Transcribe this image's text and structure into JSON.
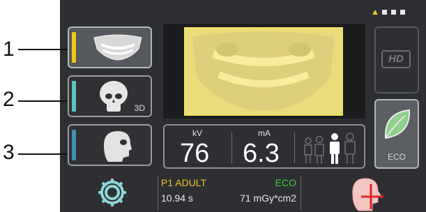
{
  "callouts": [
    "1",
    "2",
    "3"
  ],
  "modes": [
    {
      "name": "panoramic",
      "bar_color": "#f0c419",
      "active": true,
      "badge": ""
    },
    {
      "name": "skull-3d",
      "bar_color": "#5fc3bf",
      "active": false,
      "badge": "3D"
    },
    {
      "name": "cephalometric",
      "bar_color": "#3f8fb0",
      "active": false,
      "badge": ""
    }
  ],
  "params": {
    "kv_label": "kV",
    "kv_value": "76",
    "ma_label": "mA",
    "ma_value": "6.3"
  },
  "side": {
    "hd_label": "HD",
    "eco_label": "ECO"
  },
  "status": {
    "program": "P1 ADULT",
    "mode": "ECO",
    "time": "10.94 s",
    "dose": "71 mGy*cm2"
  },
  "colors": {
    "accent_yellow": "#f0c419",
    "eco_green": "#3fd13f",
    "cross_red": "#e0202a",
    "panel": "#2d2f33"
  },
  "page_indicator": {
    "count": 4,
    "active_index": 0
  }
}
